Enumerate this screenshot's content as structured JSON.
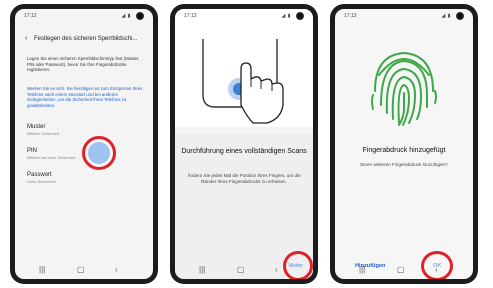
{
  "phone1": {
    "time": "17:12",
    "header_title": "Festlegen des sicheren Sperrbildschi...",
    "intro_text": "Legen Sie einen sicheren Sperrbildschirmtyp fest (Muster, PIN oder Passwort), bevor Sie Ihre Fingerabdrücke registrieren.",
    "memo_text": "Merken Sie es sich. Sie benötigen es zum Entsperren Ihres Telefons nach einem Neustart und bei anderen Gelegenheiten, um die Sicherheit Ihres Telefons zu gewährleisten.",
    "options": [
      {
        "label": "Muster",
        "sub": "Mittlere Sicherheit"
      },
      {
        "label": "PIN",
        "sub": "Mittlere bis hohe Sicherheit"
      },
      {
        "label": "Passwort",
        "sub": "Hohe Sicherheit"
      }
    ]
  },
  "phone2": {
    "time": "17:13",
    "title": "Durchführung eines vollständigen Scans",
    "description": "Ändern Sie jedes Mal die Position Ihres Fingers, um die Ränder Ihres Fingerabdrucks zu erfassen.",
    "next_label": "Weiter"
  },
  "phone3": {
    "time": "17:13",
    "title": "Fingerabdruck hinzugefügt",
    "description": "Einen weiteren Fingerabdruck hinzufügen?",
    "add_label": "Hinzufügen",
    "ok_label": "OK"
  },
  "status_icons": "◢ ▮",
  "colors": {
    "accent_blue": "#1a5fcf",
    "highlight_red": "#e0202a",
    "fingerprint_green": "#3fa846"
  }
}
